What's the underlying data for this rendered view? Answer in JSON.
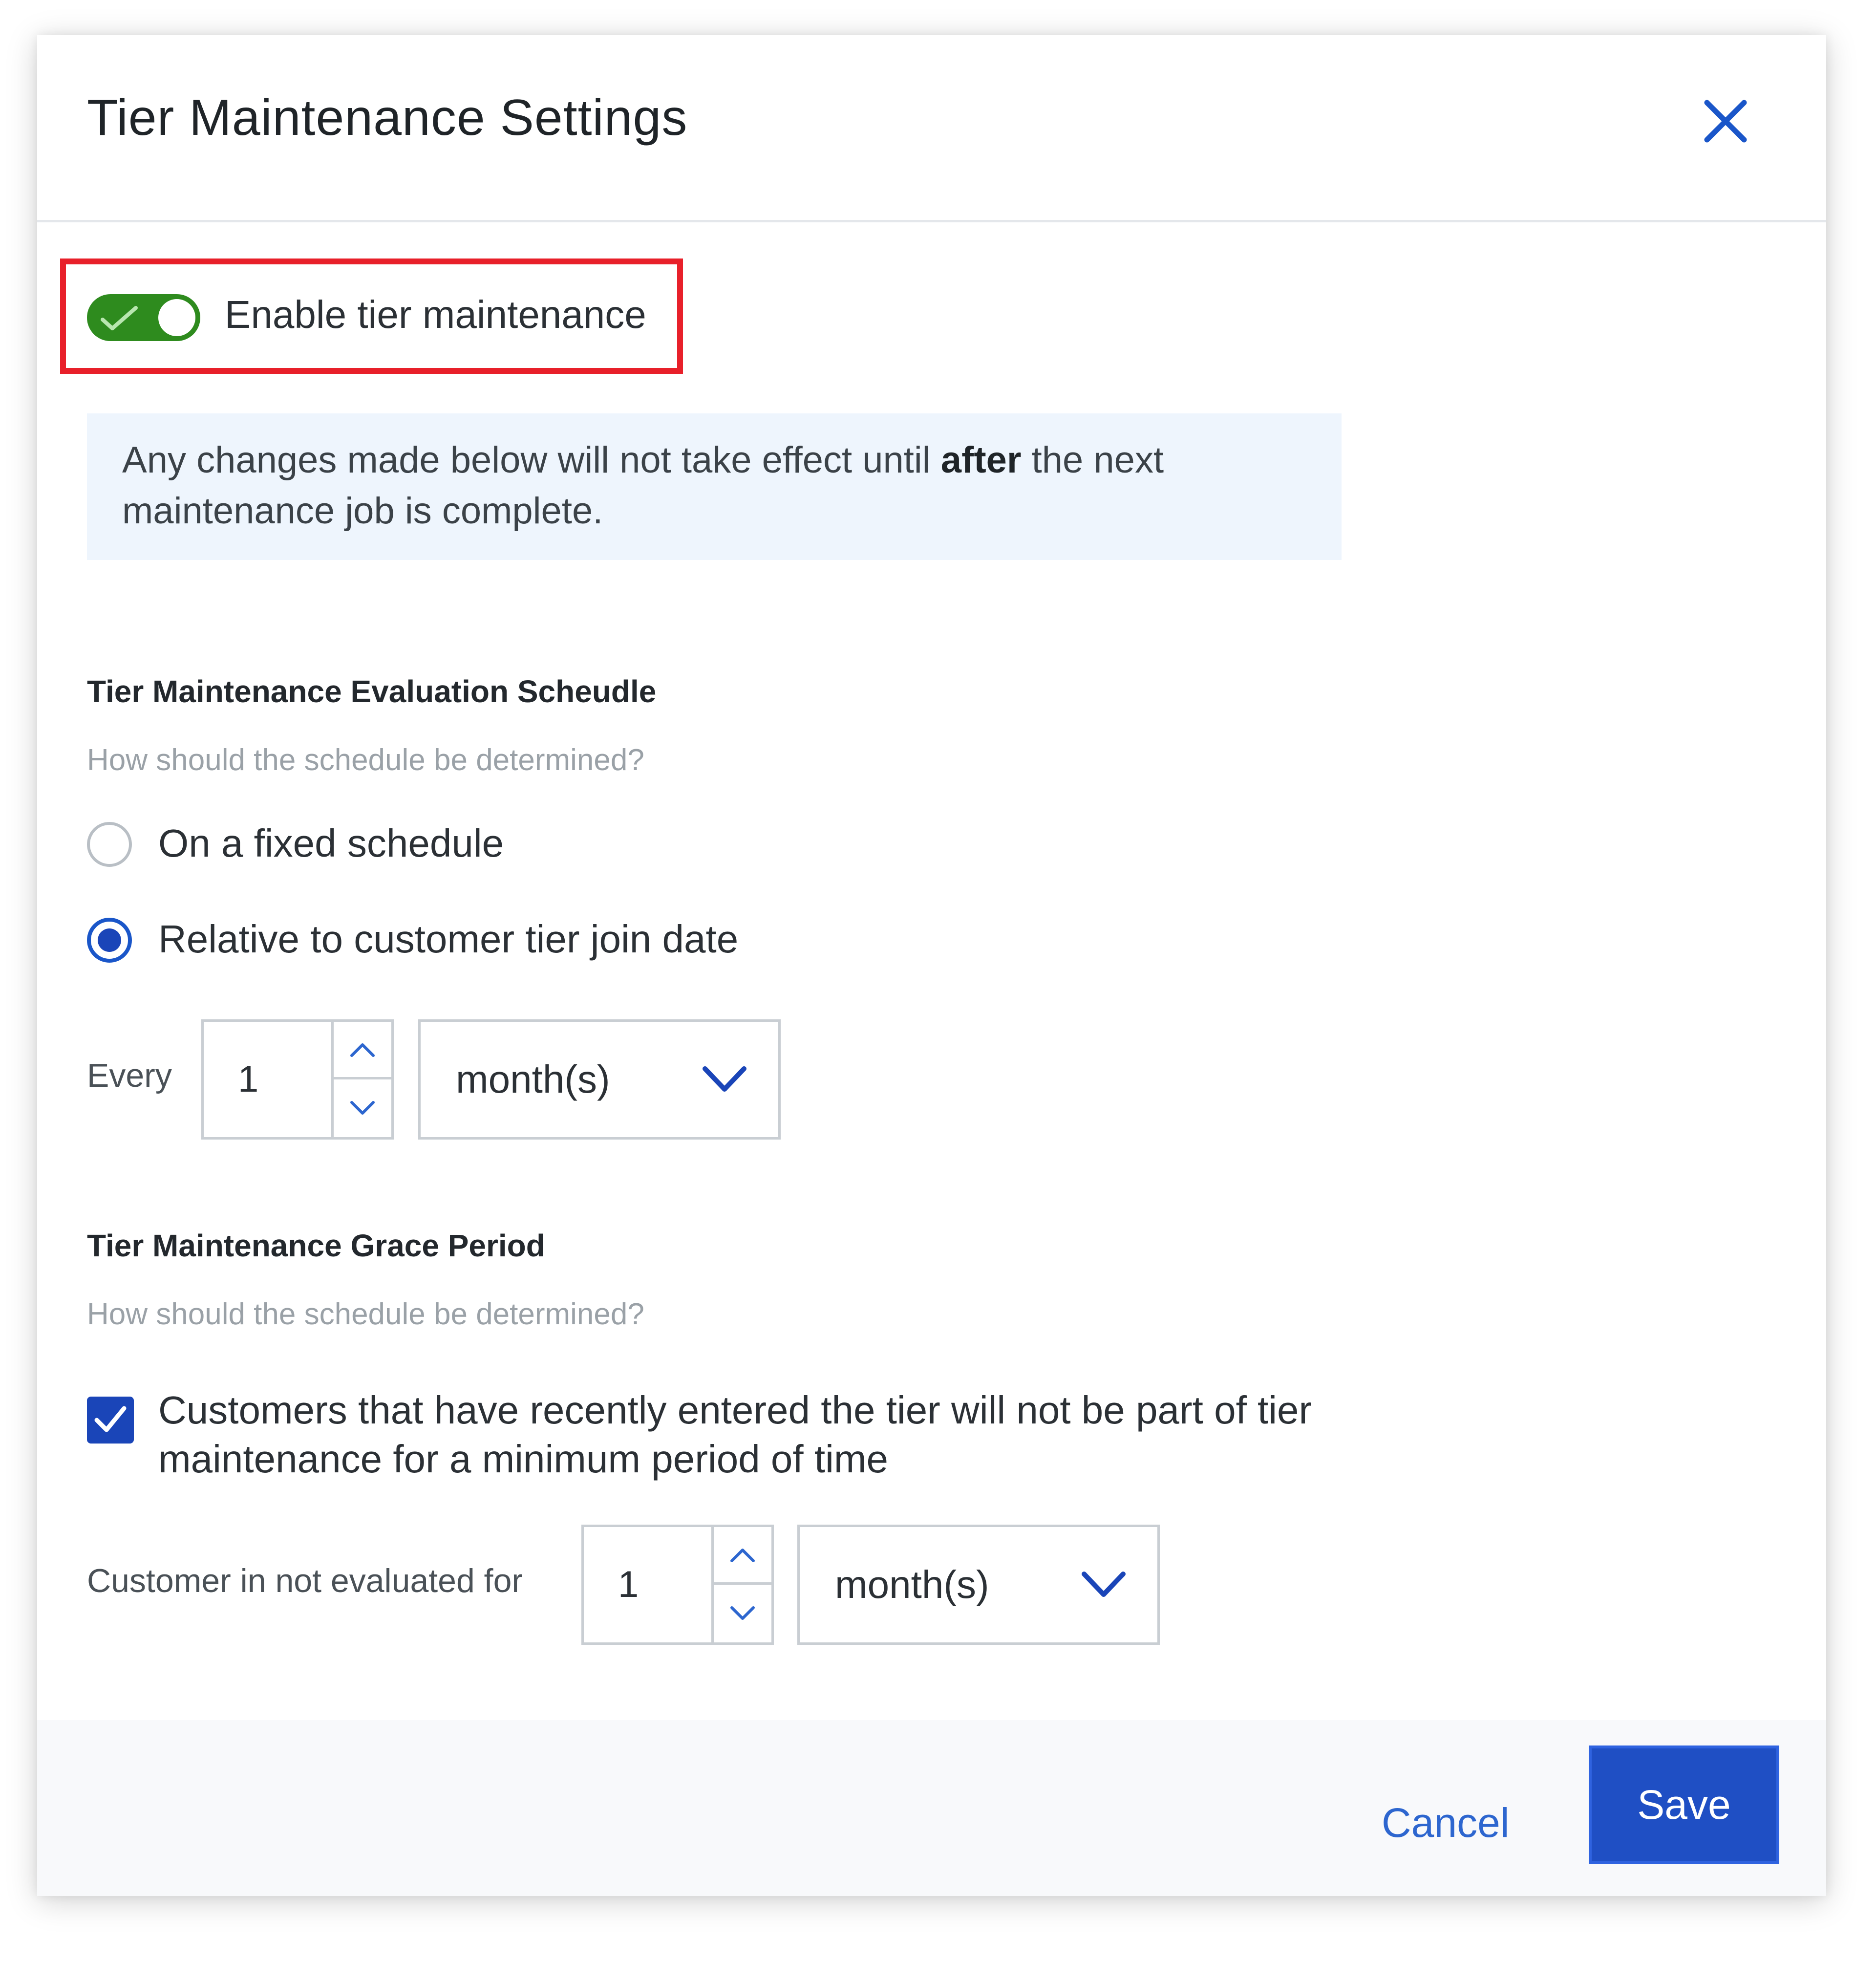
{
  "dialog": {
    "title": "Tier Maintenance Settings",
    "close_icon": "close-icon"
  },
  "toggle": {
    "label": "Enable tier maintenance",
    "state": "on",
    "color": "#2e8b1e"
  },
  "info_banner": {
    "text_before": "Any changes made below will not take effect until ",
    "text_bold": "after",
    "text_after": " the next maintenance job is complete."
  },
  "evaluation": {
    "title": "Tier Maintenance Evaluation Scheudle",
    "subtitle": "How should the schedule be determined?",
    "options": [
      {
        "label": "On a fixed schedule",
        "selected": false
      },
      {
        "label": "Relative to customer tier join date",
        "selected": true
      }
    ],
    "every_label": "Every",
    "every_value": "1",
    "every_unit": "month(s)"
  },
  "grace": {
    "title": "Tier Maintenance Grace Period",
    "subtitle": "How should the schedule be determined?",
    "checkbox_checked": true,
    "checkbox_label": "Customers that have recently entered the tier will not be part of tier maintenance for a minimum period of time",
    "not_evaluated_label": "Customer in not evaluated for",
    "value": "1",
    "unit": "month(s)"
  },
  "footer": {
    "cancel_label": "Cancel",
    "save_label": "Save"
  },
  "colors": {
    "accent": "#1f4fc4",
    "highlight": "#e8202a",
    "banner": "#eef5fd"
  }
}
